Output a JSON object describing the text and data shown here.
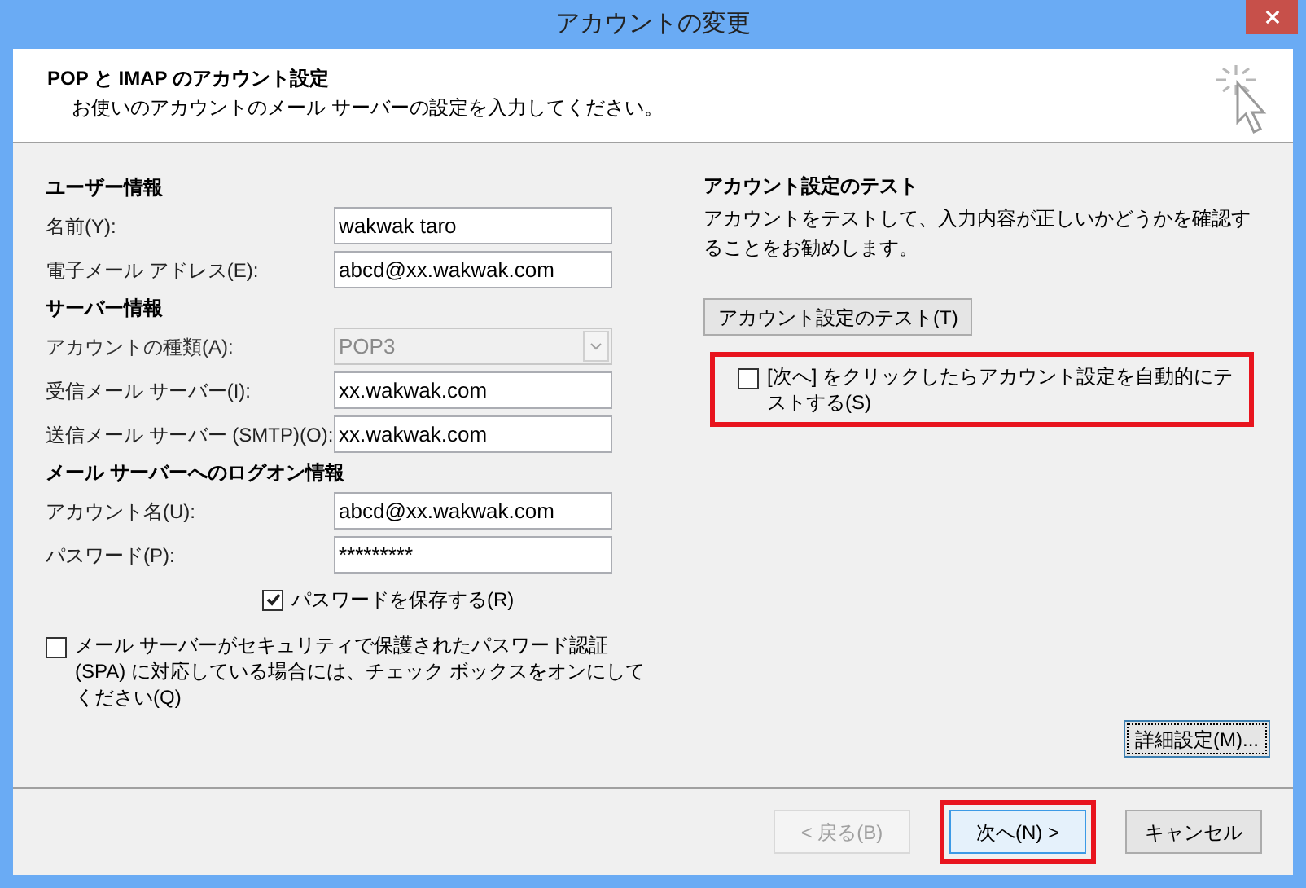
{
  "window": {
    "title": "アカウントの変更"
  },
  "header": {
    "title": "POP と IMAP のアカウント設定",
    "subtitle": "お使いのアカウントのメール サーバーの設定を入力してください。"
  },
  "left": {
    "sections": [
      {
        "title": "ユーザー情報",
        "fields": [
          {
            "kind": "text",
            "label": "名前(Y):",
            "value": "wakwak taro",
            "disabled": false
          },
          {
            "kind": "text",
            "label": "電子メール アドレス(E):",
            "value": "abcd@xx.wakwak.com",
            "disabled": false
          }
        ]
      },
      {
        "title": "サーバー情報",
        "fields": [
          {
            "kind": "dropdown",
            "label": "アカウントの種類(A):",
            "value": "POP3",
            "disabled": true
          },
          {
            "kind": "text",
            "label": "受信メール サーバー(I):",
            "value": "xx.wakwak.com",
            "disabled": false
          },
          {
            "kind": "text",
            "label": "送信メール サーバー (SMTP)(O):",
            "value": "xx.wakwak.com",
            "disabled": false
          }
        ]
      },
      {
        "title": "メール サーバーへのログオン情報",
        "fields": [
          {
            "kind": "text",
            "label": "アカウント名(U):",
            "value": "abcd@xx.wakwak.com",
            "disabled": false
          },
          {
            "kind": "password",
            "label": "パスワード(P):",
            "value": "*********",
            "disabled": false
          }
        ]
      }
    ],
    "save_password": {
      "label": "パスワードを保存する(R)",
      "checked": true
    },
    "spa": {
      "label": "メール サーバーがセキュリティで保護されたパスワード認証 (SPA) に対応している場合には、チェック ボックスをオンにしてください(Q)",
      "checked": false
    }
  },
  "right": {
    "title": "アカウント設定のテスト",
    "description": "アカウントをテストして、入力内容が正しいかどうかを確認することをお勧めします。",
    "test_button": "アカウント設定のテスト(T)",
    "auto_test": {
      "label": "[次へ] をクリックしたらアカウント設定を自動的にテストする(S)",
      "checked": false,
      "highlighted": true
    },
    "more_button": "詳細設定(M)..."
  },
  "footer": {
    "buttons": [
      {
        "label": "< 戻る(B)",
        "disabled": true,
        "default": false,
        "highlighted": false
      },
      {
        "label": "次へ(N) >",
        "disabled": false,
        "default": true,
        "highlighted": true
      },
      {
        "label": "キャンセル",
        "disabled": false,
        "default": false,
        "highlighted": false
      }
    ]
  }
}
